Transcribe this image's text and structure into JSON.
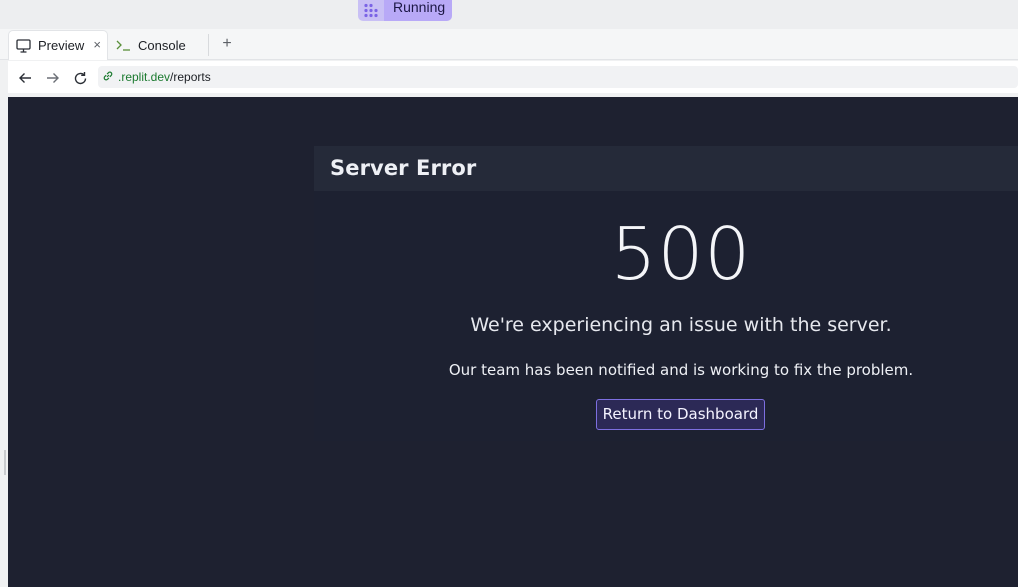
{
  "run_button": {
    "label": "Running",
    "icon": "run-grid-icon",
    "color": "#b8a9f7"
  },
  "tabs": [
    {
      "label": "Preview",
      "icon": "monitor-icon",
      "active": true
    },
    {
      "label": "Console",
      "icon": "terminal-icon",
      "active": false
    }
  ],
  "tab_close_glyph": "×",
  "tab_add_glyph": "+",
  "nav": {
    "back_icon": "arrow-left-icon",
    "forward_icon": "arrow-right-icon",
    "reload_icon": "reload-icon",
    "url_host": ".replit.dev",
    "url_path": "/reports"
  },
  "page": {
    "title": "Server Error",
    "code": "500",
    "message": "We're experiencing an issue with the server.",
    "detail": "Our team has been notified and is working to fix the problem.",
    "button_label": "Return to Dashboard",
    "background": "#1e2130",
    "accent": "#7d6fe0"
  }
}
